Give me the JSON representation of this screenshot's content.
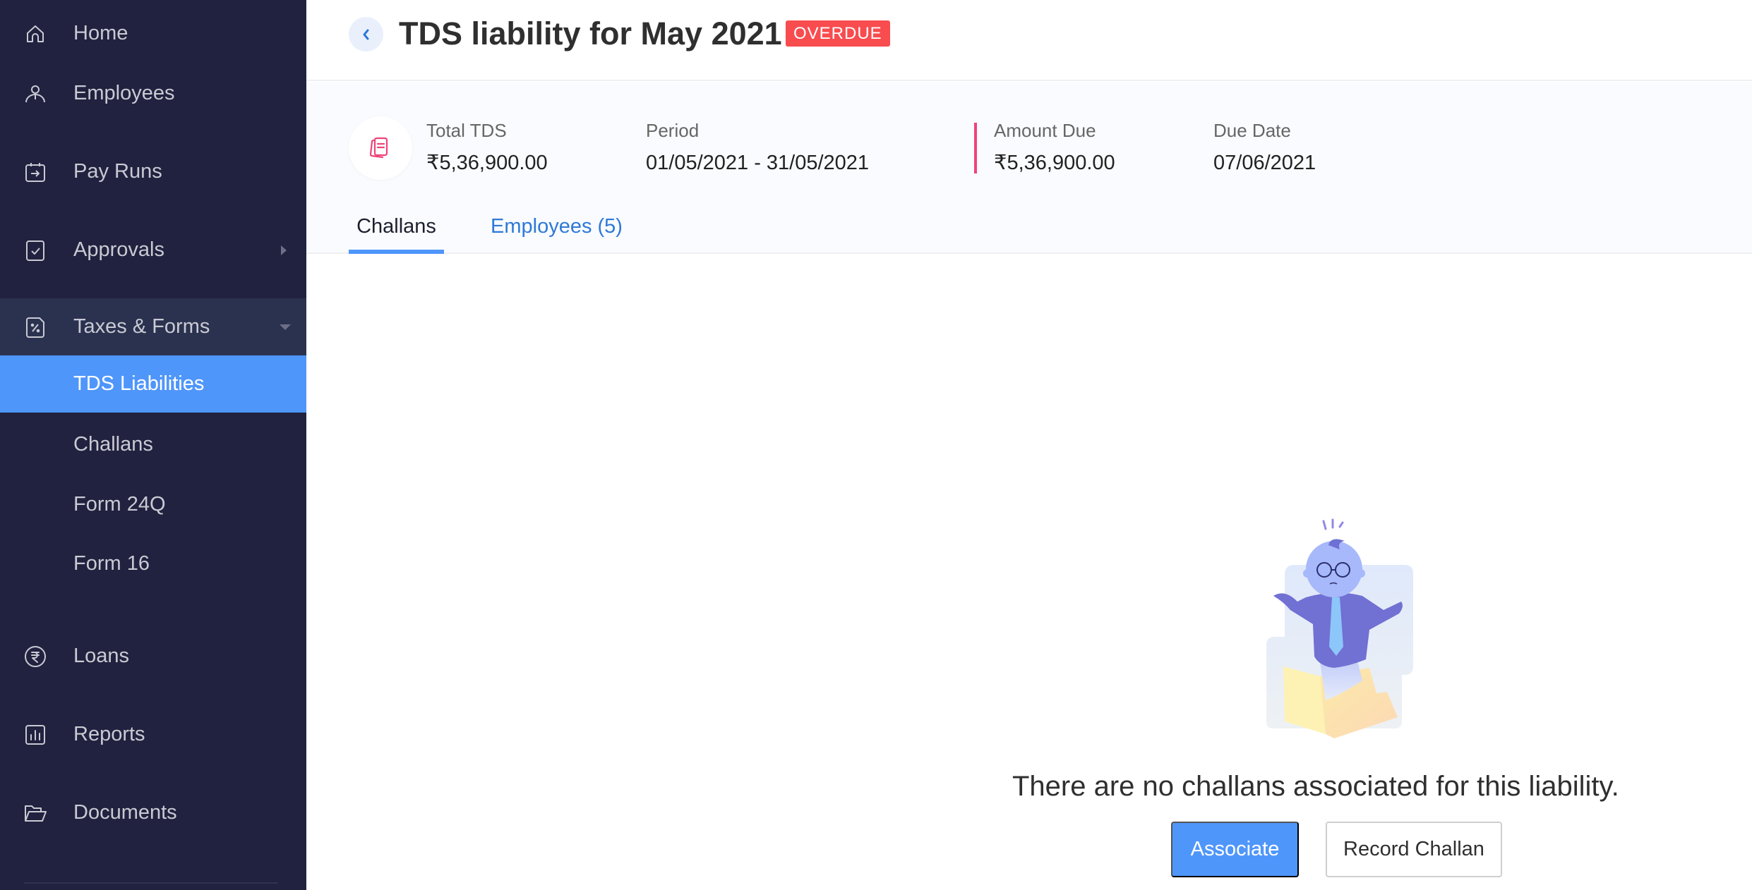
{
  "sidebar": {
    "items": [
      {
        "label": "Home",
        "icon": "home-icon"
      },
      {
        "label": "Employees",
        "icon": "user-icon"
      },
      {
        "label": "Pay Runs",
        "icon": "calendar-arrow-icon"
      },
      {
        "label": "Approvals",
        "icon": "checkbox-icon",
        "has_submenu": true
      },
      {
        "label": "Taxes & Forms",
        "icon": "percent-document-icon",
        "expanded": true
      },
      {
        "label": "TDS Liabilities",
        "active": true
      },
      {
        "label": "Challans"
      },
      {
        "label": "Form 24Q"
      },
      {
        "label": "Form 16"
      },
      {
        "label": "Loans",
        "icon": "rupee-circle-icon"
      },
      {
        "label": "Reports",
        "icon": "bar-chart-icon"
      },
      {
        "label": "Documents",
        "icon": "folder-open-icon"
      }
    ]
  },
  "header": {
    "title": "TDS liability for May 2021",
    "status_badge": "OVERDUE"
  },
  "summary": {
    "total_tds_label": "Total TDS",
    "total_tds_value": "₹5,36,900.00",
    "period_label": "Period",
    "period_value": "01/05/2021 - 31/05/2021",
    "amount_due_label": "Amount Due",
    "amount_due_value": "₹5,36,900.00",
    "due_date_label": "Due Date",
    "due_date_value": "07/06/2021"
  },
  "tabs": [
    {
      "label": "Challans",
      "active": true
    },
    {
      "label": "Employees (5)",
      "active": false
    }
  ],
  "empty_state": {
    "message": "There are no challans associated for this liability.",
    "primary_button": "Associate",
    "secondary_button": "Record Challan"
  },
  "colors": {
    "sidebar_bg": "#20223f",
    "accent": "#4f96fb",
    "overdue": "#f84c4f",
    "amount_due_marker": "#ef4379"
  }
}
